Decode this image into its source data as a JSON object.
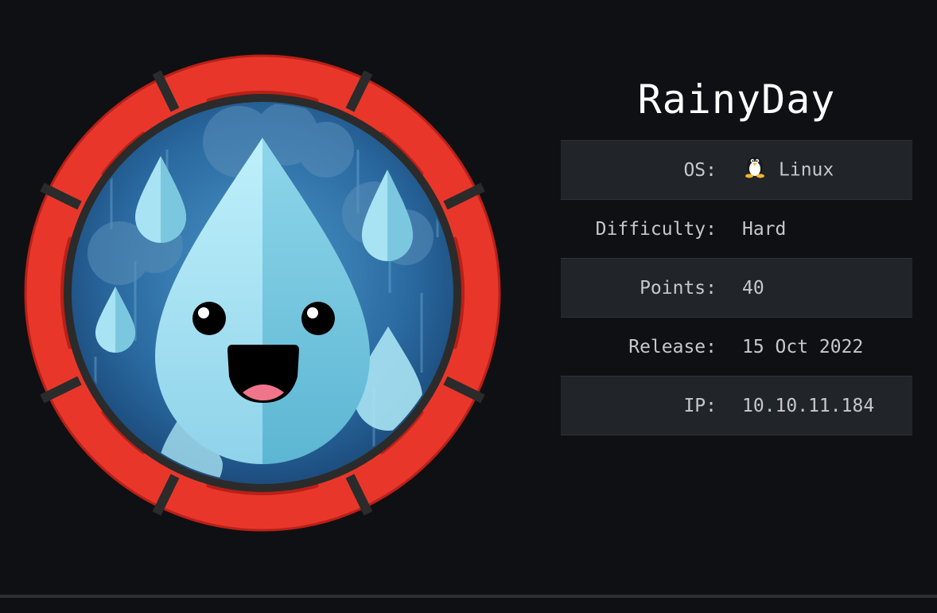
{
  "machine": {
    "name": "RainyDay",
    "logo_icon": "rain-drop-icon"
  },
  "stats": [
    {
      "label": "OS:",
      "value": "Linux",
      "icon": "linux-penguin-icon"
    },
    {
      "label": "Difficulty:",
      "value": "Hard",
      "color": "#e05b51"
    },
    {
      "label": "Points:",
      "value": "40",
      "color": "#a9d04a"
    },
    {
      "label": "Release:",
      "value": "15 Oct 2022"
    },
    {
      "label": "IP:",
      "value": "10.10.11.184"
    }
  ],
  "colors": {
    "background": "#0f1013",
    "ring": "#e8372a",
    "row_shade": "#212428"
  }
}
